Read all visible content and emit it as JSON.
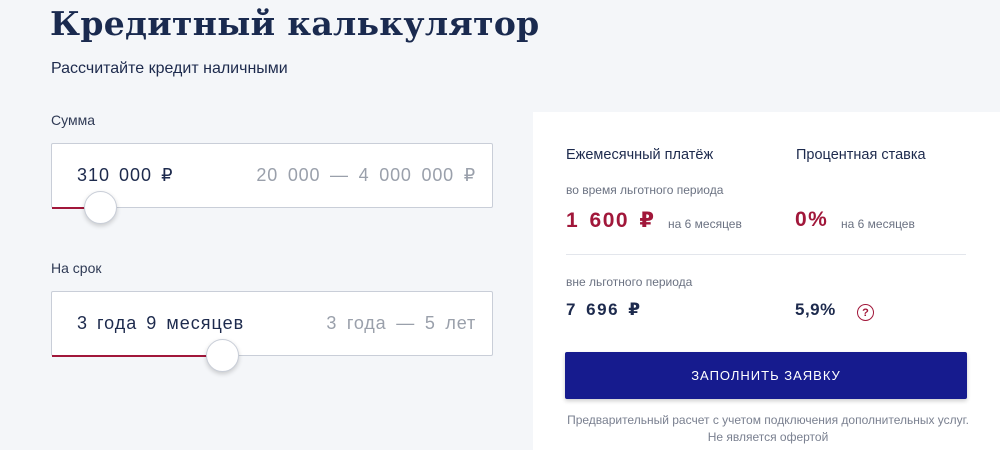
{
  "header": {
    "title": "Кредитный калькулятор",
    "subtitle": "Рассчитайте кредит наличными"
  },
  "amount": {
    "label": "Сумма",
    "value": "310 000 ₽",
    "range": "20 000 — 4 000 000 ₽",
    "slider_fraction": 0.073
  },
  "term": {
    "label": "На срок",
    "value": "3 года 9 месяцев",
    "range": "3 года — 5 лет",
    "slider_fraction": 0.375
  },
  "results": {
    "monthly_header": "Ежемесячный платёж",
    "rate_header": "Процентная ставка",
    "grace_label": "во время льготного периода",
    "grace_payment": "1 600 ₽",
    "grace_payment_note": "на 6 месяцев",
    "grace_rate": "0%",
    "grace_rate_note": "на 6 месяцев",
    "after_label": "вне льготного периода",
    "after_payment": "7 696 ₽",
    "after_rate": "5,9%",
    "help_glyph": "?"
  },
  "cta": {
    "submit_label": "ЗАПОЛНИТЬ ЗАЯВКУ"
  },
  "disclaimer": "Предварительный расчет с учетом подключения дополнительных услуг. Не является офертой",
  "colors": {
    "accent_red": "#a1173a",
    "button_blue": "#161b8e",
    "text_dark": "#1d2a4d"
  }
}
